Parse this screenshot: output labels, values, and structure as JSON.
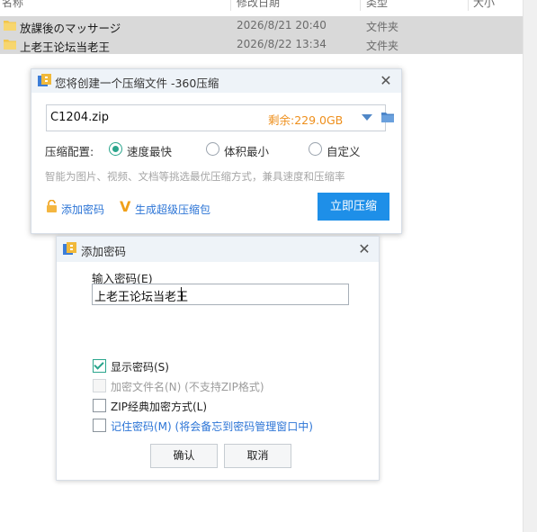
{
  "explorer": {
    "columns": {
      "name": "名称",
      "date": "修改日期",
      "type": "类型",
      "size": "大小"
    },
    "rows": [
      {
        "name": "放課後のマッサージ",
        "date": "2026/8/21 20:40",
        "type": "文件夹"
      },
      {
        "name": "上老王论坛当老王",
        "date": "2026/8/22 13:34",
        "type": "文件夹"
      }
    ]
  },
  "compress_dialog": {
    "title": "您将创建一个压缩文件 -360压缩",
    "filename": "C1204.zip",
    "free_space": "剩余:229.0GB",
    "config_label": "压缩配置:",
    "options": [
      "速度最快",
      "体积最小",
      "自定义"
    ],
    "selected_option": "速度最快",
    "hint": "智能为图片、视频、文档等挑选最优压缩方式，兼具速度和压缩率",
    "add_password_link": "添加密码",
    "super_zip_link": "生成超级压缩包",
    "compress_button": "立即压缩"
  },
  "password_dialog": {
    "title": "添加密码",
    "input_label": "输入密码(E)",
    "password_value": "上老王论坛当老王",
    "show_password": "显示密码(S)",
    "encrypt_filenames": "加密文件名(N) (不支持ZIP格式)",
    "zip_classic": "ZIP经典加密方式(L)",
    "remember_password": "记住密码(M) (将会备忘到密码管理窗口中)",
    "ok": "确认",
    "cancel": "取消"
  },
  "colors": {
    "accent": "#1e8fe8",
    "check": "#2aa58c",
    "link": "#2b74d6",
    "space": "#ee8f1c"
  }
}
